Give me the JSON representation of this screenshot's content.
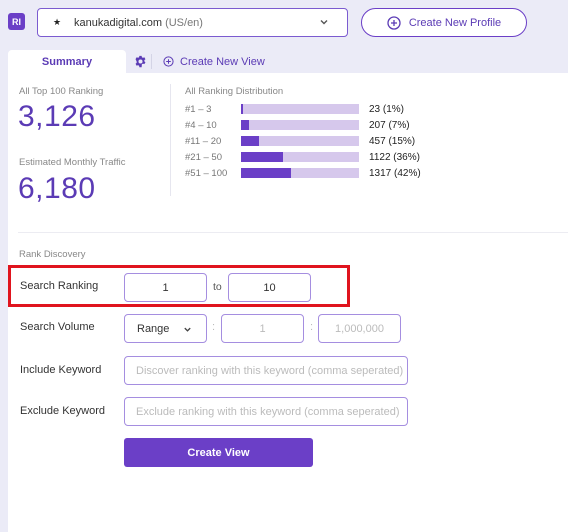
{
  "header": {
    "badge": "RI",
    "profile": {
      "favicon_icon": "star-icon",
      "domain": "kanukadigital.com",
      "locale": "(US/en)"
    },
    "create_profile_label": "Create New Profile"
  },
  "tabs": {
    "summary_label": "Summary",
    "create_view_label": "Create New View"
  },
  "summary": {
    "top100_label": "All Top 100 Ranking",
    "top100_value": "3,126",
    "traffic_label": "Estimated Monthly Traffic",
    "traffic_value": "6,180",
    "distribution_title": "All Ranking Distribution",
    "distribution": [
      {
        "range": "#1 – 3",
        "count": 23,
        "percent": 1,
        "label": "23 (1%)"
      },
      {
        "range": "#4 – 10",
        "count": 207,
        "percent": 7,
        "label": "207 (7%)"
      },
      {
        "range": "#11 – 20",
        "count": 457,
        "percent": 15,
        "label": "457 (15%)"
      },
      {
        "range": "#21 – 50",
        "count": 1122,
        "percent": 36,
        "label": "1122 (36%)"
      },
      {
        "range": "#51 – 100",
        "count": 1317,
        "percent": 42,
        "label": "1317 (42%)"
      }
    ]
  },
  "rank_discovery": {
    "title": "Rank Discovery",
    "search_ranking": {
      "label": "Search Ranking",
      "from": "1",
      "to_label": "to",
      "to": "10"
    },
    "search_volume": {
      "label": "Search Volume",
      "mode": "Range",
      "min_placeholder": "1",
      "max_placeholder": "1,000,000",
      "separator": ":"
    },
    "include_keyword": {
      "label": "Include Keyword",
      "placeholder": "Discover ranking with this keyword (comma seperated)"
    },
    "exclude_keyword": {
      "label": "Exclude Keyword",
      "placeholder": "Exclude ranking with this keyword (comma seperated)"
    },
    "submit_label": "Create View"
  },
  "colors": {
    "accent": "#6b3fc7",
    "bar_track": "#d6c8ec",
    "highlight": "#e0141e",
    "background": "#ebebf7"
  }
}
